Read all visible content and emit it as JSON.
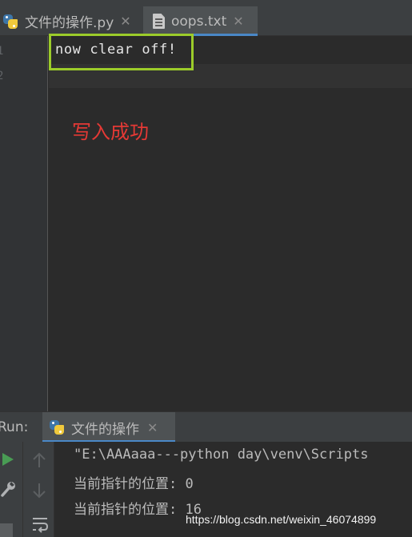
{
  "tabs": [
    {
      "label": "文件的操作.py",
      "icon": "python-file-icon",
      "active": false
    },
    {
      "label": "oops.txt",
      "icon": "text-file-icon",
      "active": true
    }
  ],
  "close_glyph": "✕",
  "editor": {
    "line_numbers": [
      "1",
      "2"
    ],
    "lines": [
      "now clear off!",
      ""
    ],
    "annotation": "写入成功",
    "highlight_color": "#9ccc2a",
    "annotation_color": "#e53935"
  },
  "run": {
    "title": "Run:",
    "tab_label": "文件的操作",
    "console_lines": [
      "\"E:\\AAAaaa---python day\\venv\\Scripts",
      "当前指针的位置: 0",
      "当前指针的位置: 16"
    ]
  },
  "watermark": "https://blog.csdn.net/weixin_46074899"
}
